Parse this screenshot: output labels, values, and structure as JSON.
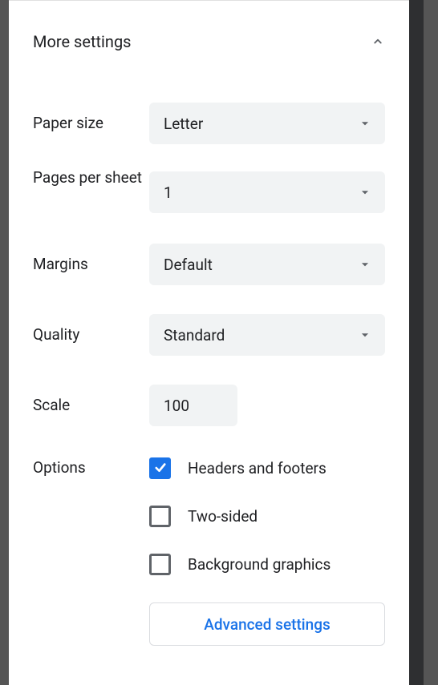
{
  "section": {
    "title": "More settings"
  },
  "rows": {
    "paper_size": {
      "label": "Paper size",
      "value": "Letter"
    },
    "pages_per_sheet": {
      "label": "Pages per sheet",
      "value": "1"
    },
    "margins": {
      "label": "Margins",
      "value": "Default"
    },
    "quality": {
      "label": "Quality",
      "value": "Standard"
    },
    "scale": {
      "label": "Scale",
      "value": "100"
    }
  },
  "options": {
    "label": "Options",
    "headers_footers": {
      "label": "Headers and footers",
      "checked": true
    },
    "two_sided": {
      "label": "Two-sided",
      "checked": false
    },
    "background_graphics": {
      "label": "Background graphics",
      "checked": false
    }
  },
  "advanced_settings": {
    "label": "Advanced settings"
  }
}
